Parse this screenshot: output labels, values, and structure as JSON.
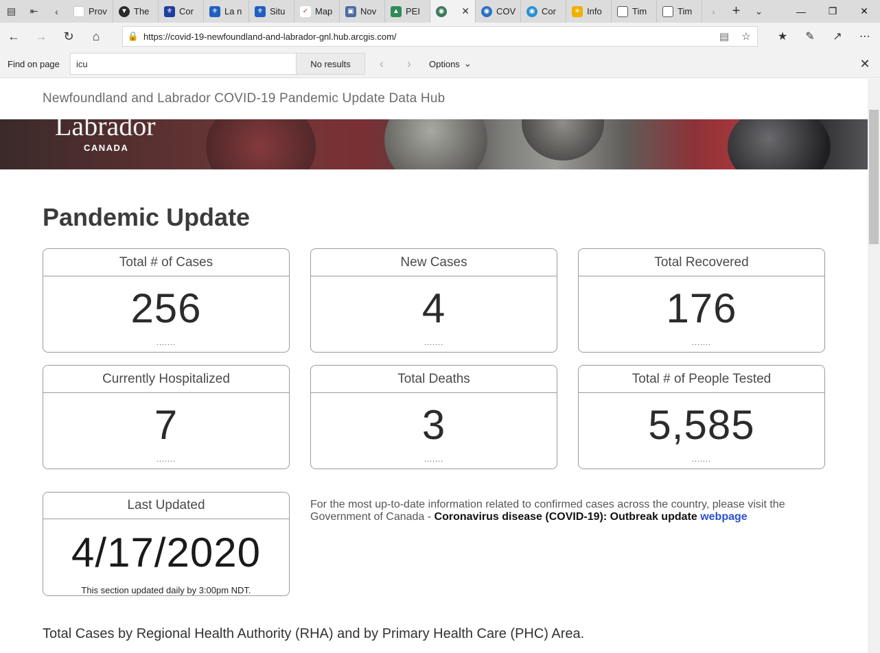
{
  "browser": {
    "tabs": [
      {
        "title": "Prov",
        "color": "#ffffff"
      },
      {
        "title": "The",
        "color": "#2a2a2a"
      },
      {
        "title": "Cor",
        "color": "#1f3f9e"
      },
      {
        "title": "La n",
        "color": "#1f5fbf"
      },
      {
        "title": "Situ",
        "color": "#1f5fbf"
      },
      {
        "title": "Map",
        "color": "#b23030"
      },
      {
        "title": "Nov",
        "color": "#4a6aa0"
      },
      {
        "title": "PEI",
        "color": "#2e8b57"
      },
      {
        "title": "",
        "color": "#3a7a5a"
      },
      {
        "title": "COV",
        "color": "#2a6fbf"
      },
      {
        "title": "Cor",
        "color": "#2a8fcf"
      },
      {
        "title": "Info",
        "color": "#f0b000"
      },
      {
        "title": "Tim",
        "color": "#ffffff"
      },
      {
        "title": "Tim",
        "color": "#ffffff"
      }
    ],
    "url": "https://covid-19-newfoundland-and-labrador-gnl.hub.arcgis.com/",
    "find": {
      "label": "Find on page",
      "query": "icu",
      "results": "No results",
      "options": "Options"
    }
  },
  "site": {
    "title": "Newfoundland and Labrador COVID-19 Pandemic Update Data Hub",
    "banner_word": "Labrador",
    "banner_country": "CANADA"
  },
  "page": {
    "heading": "Pandemic Update",
    "cards": [
      {
        "title": "Total # of Cases",
        "value": "256",
        "dots": "......."
      },
      {
        "title": "New Cases",
        "value": "4",
        "dots": "......."
      },
      {
        "title": "Total Recovered",
        "value": "176",
        "dots": "......."
      },
      {
        "title": "Currently Hospitalized",
        "value": "7",
        "dots": "......."
      },
      {
        "title": "Total Deaths",
        "value": "3",
        "dots": "......."
      },
      {
        "title": "Total # of People Tested",
        "value": "5,585",
        "dots": "......."
      }
    ],
    "last_updated": {
      "title": "Last Updated",
      "value": "4/17/2020",
      "note": "This section updated daily by 3:00pm NDT."
    },
    "info": {
      "text_1": "For the most up-to-date information related to confirmed cases across the country, please visit the Government of Canada - ",
      "bold": "Coronavirus disease (COVID-19): Outbreak update",
      "link": "webpage"
    },
    "section_title": "Total Cases by Regional Health Authority (RHA) and by Primary Health Care (PHC) Area."
  }
}
